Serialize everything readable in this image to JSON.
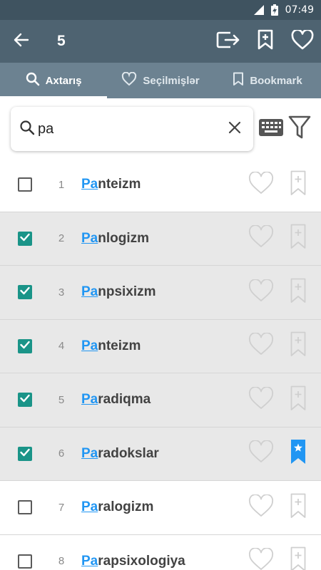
{
  "status_bar": {
    "time": "07:49",
    "icons": [
      "signal-icon",
      "battery-charging-icon"
    ]
  },
  "toolbar": {
    "selected_count": "5",
    "icons": [
      "back-arrow-icon",
      "export-icon",
      "add-bookmark-icon",
      "heart-icon"
    ]
  },
  "tabs": [
    {
      "label": "Axtarış",
      "icon": "search-icon",
      "active": true
    },
    {
      "label": "Seçilmişlər",
      "icon": "heart-outline-icon",
      "active": false
    },
    {
      "label": "Bookmark",
      "icon": "bookmark-outline-icon",
      "active": false
    }
  ],
  "search": {
    "value": "pa",
    "placeholder": "",
    "icons": [
      "search-icon",
      "clear-icon",
      "keyboard-icon",
      "filter-icon"
    ]
  },
  "list": [
    {
      "num": "1",
      "prefix": "Pa",
      "rest": "nteizm",
      "checked": false,
      "favorite": false,
      "bookmarked": false
    },
    {
      "num": "2",
      "prefix": "Pa",
      "rest": "nlogizm",
      "checked": true,
      "favorite": false,
      "bookmarked": false
    },
    {
      "num": "3",
      "prefix": "Pa",
      "rest": "npsixizm",
      "checked": true,
      "favorite": false,
      "bookmarked": false
    },
    {
      "num": "4",
      "prefix": "Pa",
      "rest": "nteizm",
      "checked": true,
      "favorite": false,
      "bookmarked": false
    },
    {
      "num": "5",
      "prefix": "Pa",
      "rest": "radiqma",
      "checked": true,
      "favorite": false,
      "bookmarked": false
    },
    {
      "num": "6",
      "prefix": "Pa",
      "rest": "radokslar",
      "checked": true,
      "favorite": false,
      "bookmarked": true
    },
    {
      "num": "7",
      "prefix": "Pa",
      "rest": "ralogizm",
      "checked": false,
      "favorite": false,
      "bookmarked": false
    },
    {
      "num": "8",
      "prefix": "Pa",
      "rest": "rapsixologiya",
      "checked": false,
      "favorite": false,
      "bookmarked": false
    }
  ],
  "colors": {
    "status_bar": "#3f5360",
    "toolbar": "#4e6371",
    "tabs": "#6c8291",
    "checkbox_on": "#1a9488",
    "highlight": "#2196f3",
    "bookmark_active": "#2196f3",
    "selected_row": "#e8e8e8"
  }
}
